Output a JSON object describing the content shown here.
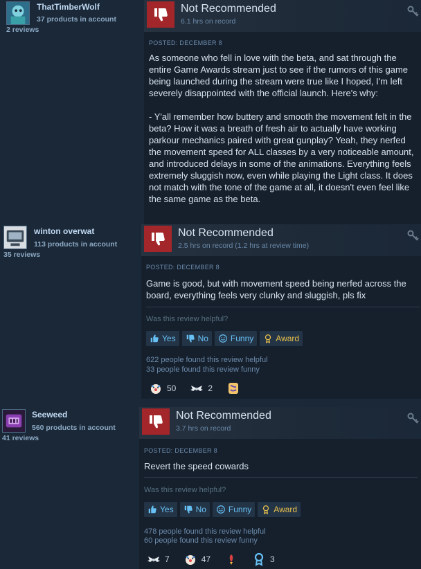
{
  "reviews": [
    {
      "username": "ThatTimberWolf",
      "products": "37 products in account",
      "reviews_count": "2 reviews",
      "recommendation": "Not Recommended",
      "hours": "6.1 hrs on record",
      "posted": "POSTED: DECEMBER 8",
      "body": "As someone who fell in love with the beta, and sat through the entire Game Awards stream just to see if the rumors of this game being launched during the stream were true like I hoped, I'm left severely disappointed with the official launch. Here's why:\n\n- Y'all remember how buttery and smooth the movement felt in the beta? How it was a breath of fresh air to actually have working parkour mechanics paired with great gunplay? Yeah, they nerfed the movement speed for ALL classes by a very noticeable amount, and introduced delays in some of the animations. Everything feels extremely sluggish now, even while playing the Light class. It does not match with the tone of the game at all, it doesn't even feel like the same game as the beta."
    },
    {
      "username": "winton overwat",
      "products": "113 products in account",
      "reviews_count": "35 reviews",
      "recommendation": "Not Recommended",
      "hours": "2.5 hrs on record (1.2 hrs at review time)",
      "posted": "POSTED: DECEMBER 8",
      "body": "Game is good, but with movement speed being nerfed across the board, everything feels very clunky and sluggish, pls fix",
      "helpful_question": "Was this review helpful?",
      "buttons": {
        "yes": "Yes",
        "no": "No",
        "funny": "Funny",
        "award": "Award"
      },
      "helpful_count": "622 people found this review helpful",
      "funny_count": "33 people found this review funny",
      "awards": [
        {
          "icon": "clown-award-icon",
          "count": "50"
        },
        {
          "icon": "wings-award-icon",
          "count": "2"
        },
        {
          "icon": "sticker-award-icon",
          "count": ""
        }
      ]
    },
    {
      "username": "Seeweed",
      "products": "560 products in account",
      "reviews_count": "41 reviews",
      "recommendation": "Not Recommended",
      "hours": "3.7 hrs on record",
      "posted": "POSTED: DECEMBER 8",
      "body": "Revert the speed cowards",
      "helpful_question": "Was this review helpful?",
      "buttons": {
        "yes": "Yes",
        "no": "No",
        "funny": "Funny",
        "award": "Award"
      },
      "helpful_count": "478 people found this review helpful",
      "funny_count": "60 people found this review funny",
      "awards": [
        {
          "icon": "wings-award-icon",
          "count": "7"
        },
        {
          "icon": "clown-award-icon",
          "count": "47"
        },
        {
          "icon": "rocket-award-icon",
          "count": ""
        },
        {
          "icon": "medal-award-icon",
          "count": "3"
        }
      ]
    }
  ],
  "colors": {
    "background": "#1b2838",
    "panel": "#16202d",
    "thumb_red": "#a3262a",
    "link_blue": "#66c0f4",
    "award_gold": "#e8c14a"
  }
}
